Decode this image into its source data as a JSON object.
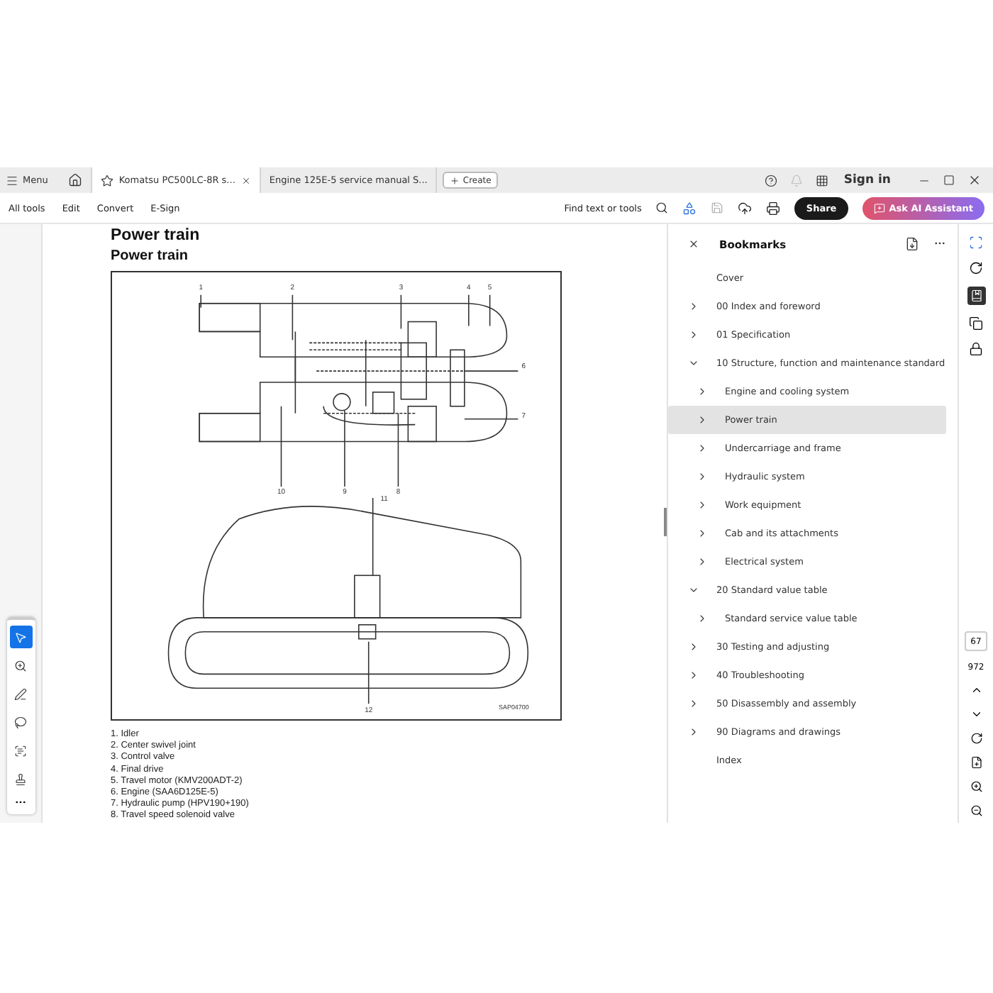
{
  "top_bar": {
    "menu": "Menu",
    "tabs": [
      {
        "label": "Komatsu PC500LC-8R s...",
        "selected": true
      },
      {
        "label": "Engine 125E-5 service manual S...",
        "selected": false
      }
    ],
    "create": "Create",
    "sign_in": "Sign in"
  },
  "toolbar": {
    "items": [
      "All tools",
      "Edit",
      "Convert",
      "E-Sign"
    ],
    "find": "Find text or tools",
    "share": "Share",
    "ai": "Ask AI Assistant"
  },
  "left_tools": [
    {
      "selected": true
    },
    {
      "selected": false
    },
    {
      "selected": false
    },
    {
      "selected": false
    },
    {
      "selected": false
    },
    {
      "selected": false
    }
  ],
  "document": {
    "title": "Power train",
    "subtitle": "Power train",
    "diagram": {
      "callouts": [
        "1",
        "2",
        "3",
        "4",
        "5",
        "6",
        "7",
        "10",
        "9",
        "8",
        "11",
        "12",
        "SAP04700"
      ]
    },
    "legend": [
      "1. Idler",
      "2. Center swivel joint",
      "3. Control valve",
      "4. Final drive",
      "5. Travel motor (KMV200ADT-2)",
      "6. Engine (SAA6D125E-5)",
      "7. Hydraulic pump (HPV190+190)",
      "8. Travel speed solenoid valve"
    ]
  },
  "bookmarks": {
    "title": "Bookmarks",
    "items": [
      {
        "label": "Cover",
        "selected": false
      },
      {
        "label": "00 Index and foreword",
        "selected": false,
        "expanded": false
      },
      {
        "label": "01 Specification",
        "selected": false,
        "expanded": false
      },
      {
        "label": "10 Structure, function and maintenance standard",
        "selected": false,
        "expanded": true,
        "children": [
          {
            "label": "Engine and cooling system",
            "selected": false,
            "expanded": false
          },
          {
            "label": "Power train",
            "selected": true,
            "expanded": false
          },
          {
            "label": "Undercarriage and frame",
            "selected": false,
            "expanded": false
          },
          {
            "label": "Hydraulic system",
            "selected": false,
            "expanded": false
          },
          {
            "label": "Work equipment",
            "selected": false,
            "expanded": false
          },
          {
            "label": "Cab and its attachments",
            "selected": false,
            "expanded": false
          },
          {
            "label": "Electrical system",
            "selected": false,
            "expanded": false
          }
        ]
      },
      {
        "label": "20 Standard value table",
        "selected": false,
        "expanded": true,
        "children": [
          {
            "label": "Standard service value table",
            "selected": false,
            "expanded": false
          }
        ]
      },
      {
        "label": "30 Testing and adjusting",
        "selected": false,
        "expanded": false
      },
      {
        "label": "40 Troubleshooting",
        "selected": false,
        "expanded": false
      },
      {
        "label": "50 Disassembly and assembly",
        "selected": false,
        "expanded": false
      },
      {
        "label": "90 Diagrams and drawings",
        "selected": false,
        "expanded": false
      },
      {
        "label": "Index",
        "selected": false
      }
    ]
  },
  "page_nav": {
    "current": "67",
    "total": "972"
  }
}
